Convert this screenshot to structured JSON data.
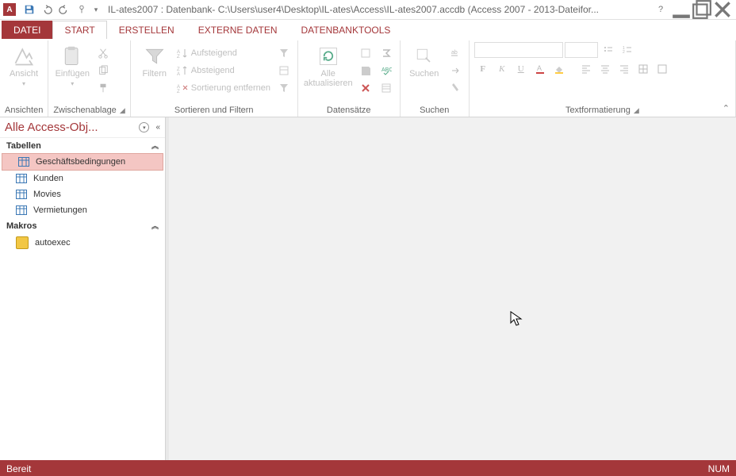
{
  "title": "IL-ates2007 : Datenbank- C:\\Users\\user4\\Desktop\\IL-ates\\Access\\IL-ates2007.accdb (Access 2007 - 2013-Dateifor...",
  "tabs": {
    "file": "DATEI",
    "start": "START",
    "erstellen": "ERSTELLEN",
    "externe": "EXTERNE DATEN",
    "dbtools": "DATENBANKTOOLS"
  },
  "ribbon": {
    "ansichten": {
      "label": "Ansichten",
      "ansicht": "Ansicht"
    },
    "zwischenablage": {
      "label": "Zwischenablage",
      "einfuegen": "Einfügen"
    },
    "sortfilter": {
      "label": "Sortieren und Filtern",
      "filtern": "Filtern",
      "aufsteigend": "Aufsteigend",
      "absteigend": "Absteigend",
      "sortentf": "Sortierung entfernen"
    },
    "datensaetze": {
      "label": "Datensätze",
      "alleakt": "Alle\naktualisieren"
    },
    "suchen": {
      "label": "Suchen",
      "suchen": "Suchen"
    },
    "textfmt": {
      "label": "Textformatierung"
    }
  },
  "nav": {
    "header": "Alle Access-Obj...",
    "tabellen": "Tabellen",
    "makros": "Makros",
    "items": [
      "Geschäftsbedingungen",
      "Kunden",
      "Movies",
      "Vermietungen"
    ],
    "macroItems": [
      "autoexec"
    ]
  },
  "status": {
    "left": "Bereit",
    "right": "NUM"
  }
}
